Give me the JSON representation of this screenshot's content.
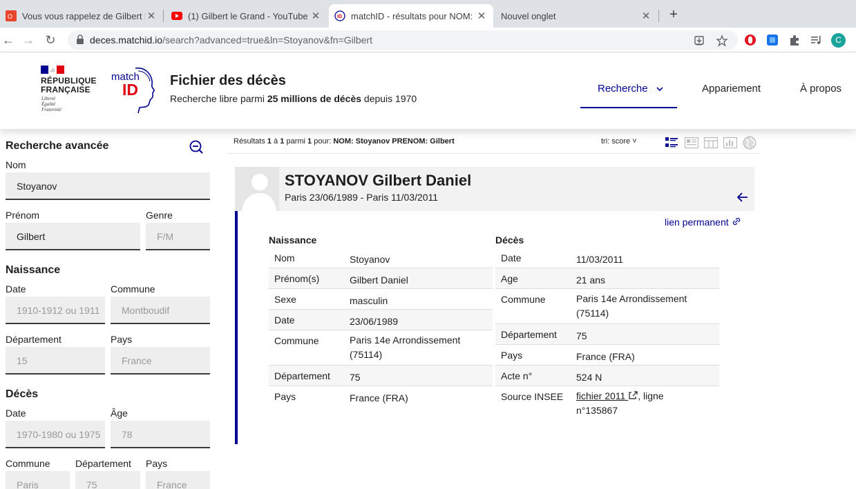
{
  "browser": {
    "tabs": [
      {
        "title": "Vous vous rappelez de Gilbert le",
        "favicon": "tab-favicon-site-icon"
      },
      {
        "title": "(1) Gilbert le Grand - YouTube",
        "favicon": "youtube-icon"
      },
      {
        "title": "matchID - résultats pour NOM:",
        "favicon": "matchid-icon",
        "active": true
      },
      {
        "title": "Nouvel onglet",
        "favicon": ""
      }
    ],
    "new_tab": "+",
    "url_host": "deces.matchid.io",
    "url_path": "/search?advanced=true&ln=Stoyanov&fn=Gilbert",
    "avatar_letter": "C"
  },
  "header": {
    "republique_line1": "RÉPUBLIQUE",
    "republique_line2": "FRANÇAISE",
    "devise": [
      "Liberté",
      "Égalité",
      "Fraternité"
    ],
    "logo_match": "match",
    "logo_id": "ID",
    "title": "Fichier des décès",
    "subtitle_pre": "Recherche libre parmi ",
    "subtitle_bold": "25 millions de décès",
    "subtitle_post": " depuis 1970",
    "menu": {
      "search": "Recherche",
      "matching": "Appariement",
      "about": "À propos"
    }
  },
  "sidebar": {
    "title": "Recherche avancée",
    "nom_label": "Nom",
    "nom_value": "Stoyanov",
    "prenom_label": "Prénom",
    "prenom_value": "Gilbert",
    "genre_label": "Genre",
    "genre_placeholder": "F/M",
    "naissance_title": "Naissance",
    "naissance_date_label": "Date",
    "naissance_date_placeholder": "1910-1912 ou 1911",
    "naissance_commune_label": "Commune",
    "naissance_commune_placeholder": "Montboudif",
    "naissance_dept_label": "Département",
    "naissance_dept_placeholder": "15",
    "naissance_pays_label": "Pays",
    "naissance_pays_placeholder": "France",
    "deces_title": "Décès",
    "deces_date_label": "Date",
    "deces_date_placeholder": "1970-1980 ou 1975",
    "deces_age_label": "Âge",
    "deces_age_placeholder": "78",
    "deces_commune_label": "Commune",
    "deces_commune_placeholder": "Paris",
    "deces_dept_label": "Département",
    "deces_dept_placeholder": "75",
    "deces_pays_label": "Pays",
    "deces_pays_placeholder": "France"
  },
  "results": {
    "prefix": "Résultats ",
    "from": "1",
    "to_word": " à ",
    "to": "1",
    "among": " parmi ",
    "total": "1",
    "for": " pour: ",
    "query": "NOM: Stoyanov PRENOM: Gilbert",
    "sort_label": "tri: score",
    "sort_chevron": "˅"
  },
  "card": {
    "name": "STOYANOV Gilbert Daniel",
    "dates": "Paris 23/06/1989 - Paris 11/03/2011",
    "permalink": "lien permanent",
    "naissance_title": "Naissance",
    "deces_title": "Décès",
    "naissance": [
      {
        "k": "Nom",
        "v": "Stoyanov"
      },
      {
        "k": "Prénom(s)",
        "v": "Gilbert Daniel"
      },
      {
        "k": "Sexe",
        "v": "masculin"
      },
      {
        "k": "Date",
        "v": "23/06/1989"
      },
      {
        "k": "Commune",
        "v1": "Paris 14e Arrondissement",
        "v2": "(75114)"
      },
      {
        "k": "Département",
        "v": "75"
      },
      {
        "k": "Pays",
        "v": "France (FRA)"
      }
    ],
    "deces": [
      {
        "k": "Date",
        "v": "11/03/2011"
      },
      {
        "k": "Age",
        "v": "21 ans"
      },
      {
        "k": "Commune",
        "v1": "Paris 14e Arrondissement",
        "v2": "(75114)"
      },
      {
        "k": "Département",
        "v": "75"
      },
      {
        "k": "Pays",
        "v": "France (FRA)"
      },
      {
        "k": "Acte n°",
        "v": "524 N"
      },
      {
        "k": "Source INSEE",
        "link": "fichier 2011",
        "after": ", ligne",
        "line2": "n°135867"
      }
    ]
  }
}
